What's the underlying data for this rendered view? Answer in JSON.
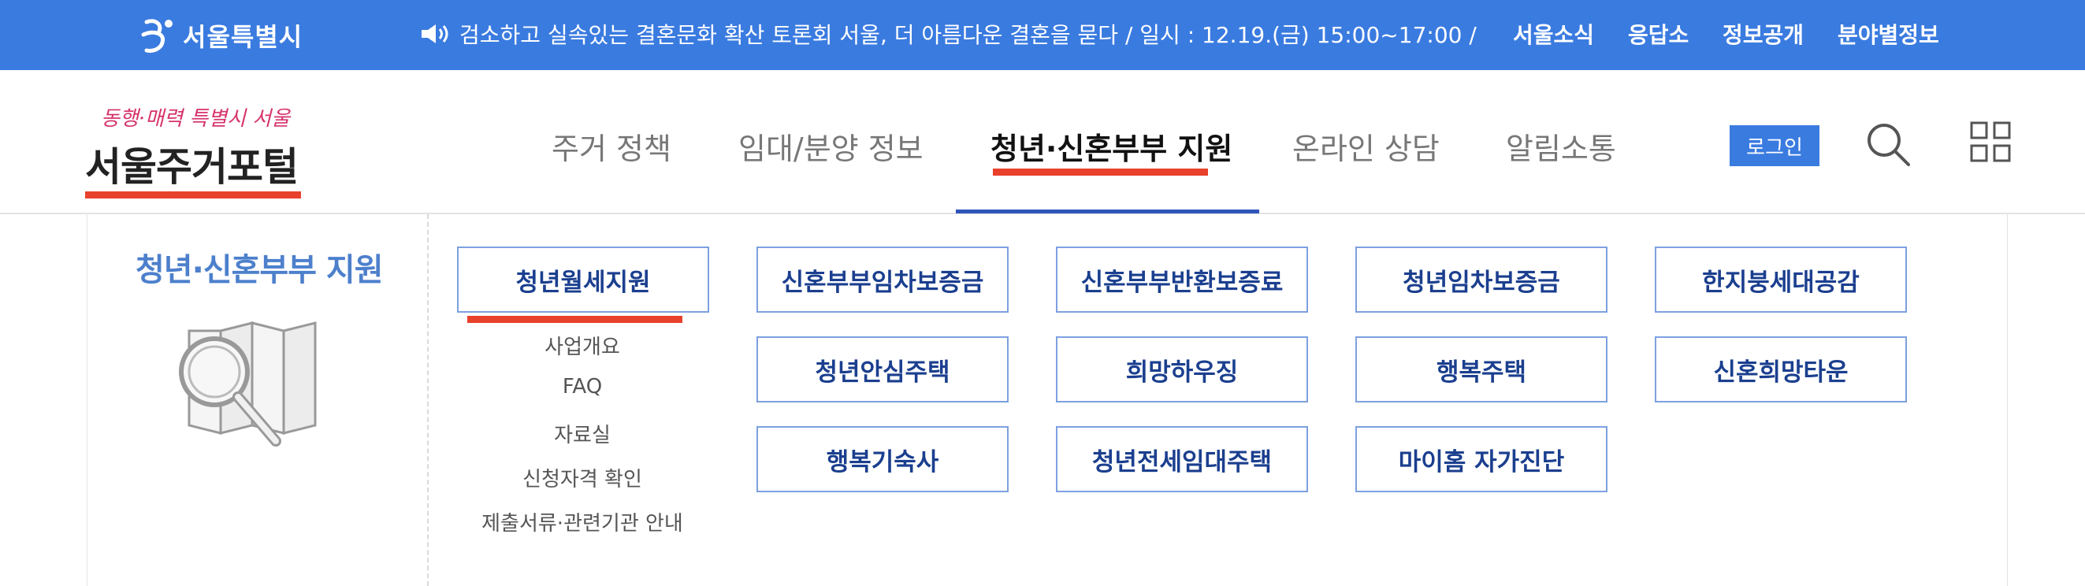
{
  "topbar": {
    "logo_text": "서울특별시",
    "notice_text": "검소하고 실속있는 결혼문화 확산 토론회 서울, 더 아름다운 결혼을 묻다 / 일시 : 12.19.(금) 15:00~17:00 / …",
    "utility_links": [
      "서울소식",
      "응답소",
      "정보공개",
      "분야별정보"
    ]
  },
  "header": {
    "portal_slogan": "동행·매력 특별시 서울",
    "portal_title": "서울주거포털",
    "gnb": [
      "주거 정책",
      "임대/분양 정보",
      "청년·신혼부부 지원",
      "온라인 상담",
      "알림소통"
    ],
    "active_gnb": "청년·신혼부부 지원",
    "login_label": "로그인"
  },
  "mega": {
    "title": "청년·신혼부부 지원",
    "menu": [
      "청년월세지원",
      "신혼부부임차보증금",
      "신혼부부반환보증료",
      "청년임차보증금",
      "한지붕세대공감",
      "청년안심주택",
      "희망하우징",
      "행복주택",
      "신혼희망타운",
      "행복기숙사",
      "청년전세임대주택",
      "마이홈 자가진단"
    ],
    "active_menu": "청년월세지원",
    "sub_items": [
      "사업개요",
      "FAQ",
      "자료실",
      "신청자격 확인",
      "제출서류·관련기관 안내"
    ]
  },
  "colors": {
    "topbar_blue": "#3a7be0",
    "accent_red": "#e8412c",
    "nav_blue": "#2f55b8",
    "title_blue": "#4d80cc",
    "box_border": "#7da0e0",
    "box_text": "#1b3f8f"
  },
  "icons": [
    "seoul-symbol-icon",
    "speaker-icon",
    "search-icon",
    "grid-menu-icon",
    "map-magnifier-illustration"
  ]
}
